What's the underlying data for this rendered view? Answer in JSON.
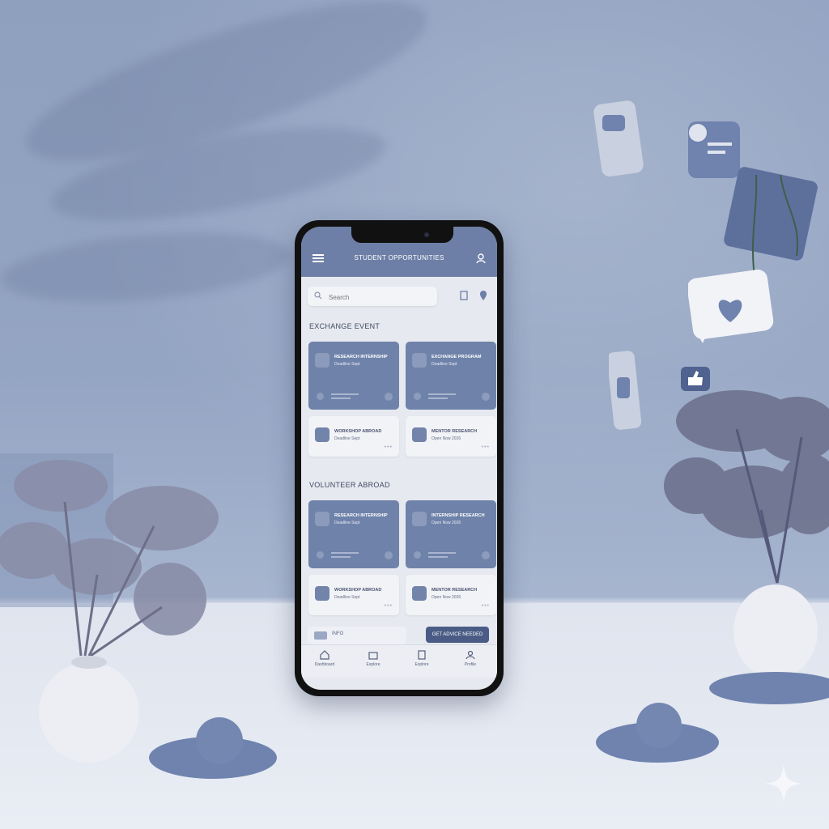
{
  "app": {
    "title": "STUDENT OPPORTUNITIES"
  },
  "search": {
    "placeholder": "Search"
  },
  "sections": [
    {
      "title": "EXCHANGE EVENT",
      "cards": [
        {
          "title": "RESEARCH INTERNSHIP",
          "subtitle": "Deadline Sept"
        },
        {
          "title": "EXCHANGE PROGRAM",
          "subtitle": "Deadline Sept"
        },
        {
          "title": "WORKSHOP ABROAD",
          "subtitle": "Deadline Sept"
        },
        {
          "title": "MENTOR RESEARCH",
          "subtitle": "Open Now 2026"
        }
      ]
    },
    {
      "title": "VOLUNTEER ABROAD",
      "cards": [
        {
          "title": "RESEARCH INTERNSHIP",
          "subtitle": "Deadline Sept"
        },
        {
          "title": "INTERNSHIP RESEARCH",
          "subtitle": "Open Now 2026"
        },
        {
          "title": "WORKSHOP ABROAD",
          "subtitle": "Deadline Sept"
        },
        {
          "title": "MENTOR RESEARCH",
          "subtitle": "Open Now 2026"
        }
      ]
    }
  ],
  "bottom_strip": {
    "label": "INFO"
  },
  "cta": {
    "label": "GET ADVICE NEEDED"
  },
  "tabs": [
    {
      "label": "Dashboard"
    },
    {
      "label": "Explore"
    },
    {
      "label": "Explore"
    },
    {
      "label": "Profile"
    }
  ],
  "colors": {
    "accent": "#6d7fa6",
    "card_dark": "#6f82aa",
    "cta": "#4a5c86",
    "background": "#94a5c3"
  }
}
